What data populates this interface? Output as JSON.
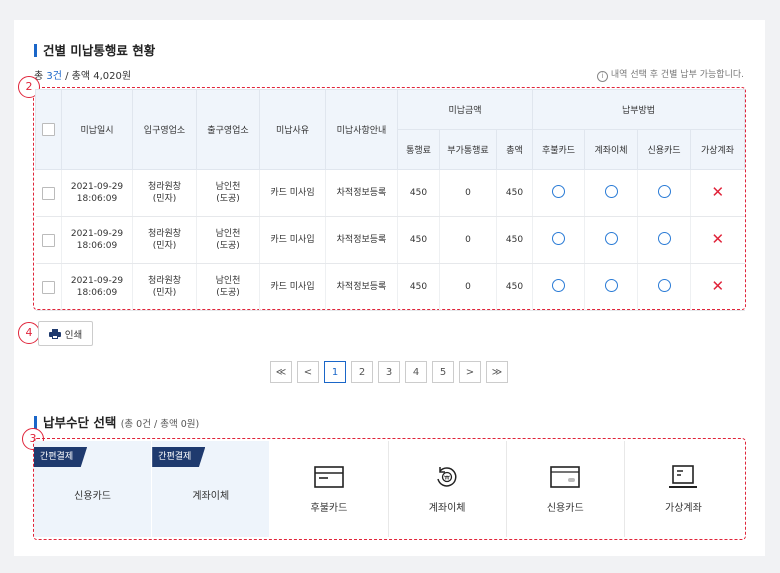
{
  "section1": {
    "title": "건별 미납통행료 현황"
  },
  "summary": {
    "prefix": "총 ",
    "count": "3건",
    "rest": " / 총액 4,020원"
  },
  "note": "내역 선택 후 건별 납부 가능합니다.",
  "badges": {
    "b1": "2",
    "b2": "4",
    "b3": "3"
  },
  "table": {
    "headers": {
      "date": "미납일시",
      "entry": "입구영업소",
      "exit": "출구영업소",
      "reason": "미납사유",
      "guide": "미납사항안내",
      "amount_group": "미납금액",
      "method_group": "납부방법",
      "toll": "통행료",
      "extra": "부가통행료",
      "total": "총액",
      "postpaid": "후불카드",
      "transfer": "계좌이체",
      "credit": "신용카드",
      "virtual": "가상계좌"
    },
    "rows": [
      {
        "date": "2021-09-29",
        "time": "18:06:09",
        "entry1": "청라원창",
        "entry2": "(민자)",
        "exit1": "남인천",
        "exit2": "(도공)",
        "reason": "카드 미사임",
        "guide": "차적정보등록",
        "toll": "450",
        "extra": "0",
        "total": "450"
      },
      {
        "date": "2021-09-29",
        "time": "18:06:09",
        "entry1": "청라원창",
        "entry2": "(민자)",
        "exit1": "남인천",
        "exit2": "(도공)",
        "reason": "카드 미사입",
        "guide": "차적정보등록",
        "toll": "450",
        "extra": "0",
        "total": "450"
      },
      {
        "date": "2021-09-29",
        "time": "18:06:09",
        "entry1": "청라원창",
        "entry2": "(민자)",
        "exit1": "남인천",
        "exit2": "(도공)",
        "reason": "카드 미사입",
        "guide": "차적정보등록",
        "toll": "450",
        "extra": "0",
        "total": "450"
      }
    ]
  },
  "print_button": "인쇄",
  "pagination": {
    "first": "≪",
    "prev": "<",
    "pages": [
      "1",
      "2",
      "3",
      "4",
      "5"
    ],
    "next": ">",
    "last": "≫",
    "current": "1"
  },
  "section2": {
    "title": "납부수단 선택",
    "sub": "(총 0건 / 총액 0원)"
  },
  "payment": {
    "simple_tag": "간편결제",
    "simple_credit": "신용카드",
    "simple_transfer": "계좌이체",
    "postpaid": "후불카드",
    "transfer": "계좌이체",
    "credit": "신용카드",
    "virtual": "가상계좌"
  },
  "colors": {
    "accent": "#1a66c8",
    "navy": "#1f3a6e",
    "highlight": "#e0243a"
  }
}
